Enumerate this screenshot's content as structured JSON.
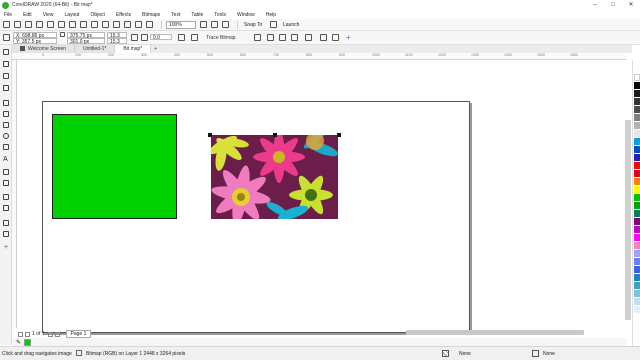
{
  "window": {
    "title": "CorelDRAW 2020 (64-Bit) - Bit map*",
    "controls": [
      "–",
      "□",
      "✕"
    ]
  },
  "menu": [
    "File",
    "Edit",
    "View",
    "Layout",
    "Object",
    "Effects",
    "Bitmaps",
    "Text",
    "Table",
    "Tools",
    "Window",
    "Help"
  ],
  "toolbar": {
    "zoom": "100%",
    "snap_to": "Snap To",
    "launch": "Launch"
  },
  "property_bar": {
    "x": "X: 698.86 px",
    "y": "Y: 357.5 px",
    "width": "375.75 px",
    "height": "301.0 px",
    "scale_w": "15.3",
    "scale_h": "15.3",
    "angle": "0.0",
    "trace_bitmap": "Trace Bitmap"
  },
  "tabs": [
    "Welcome Screen",
    "Untitled-1*",
    "Bit map*"
  ],
  "ruler_numbers": [
    "0",
    "100",
    "200",
    "300",
    "400",
    "500",
    "600",
    "700",
    "800",
    "900",
    "1000",
    "1100",
    "1200",
    "1300",
    "1400",
    "1500",
    "1600"
  ],
  "page_nav": {
    "page_label": "Page 1"
  },
  "status": {
    "hint": "Click and drag navigates image",
    "object_info": "Bitmap (RGB) on Layer 1 2448 x 3264 pixels",
    "fill": "None",
    "outline": "None"
  },
  "colors": {
    "green_fill": "#00d100",
    "palette": [
      "#ffffff",
      "#000000",
      "#1a1a1a",
      "#333333",
      "#4d4d4d",
      "#808080",
      "#b3b3b3",
      "#e6e6e6",
      "#00a3e0",
      "#0050b4",
      "#2020c0",
      "#ff0000",
      "#e2001a",
      "#ff8000",
      "#ffff00",
      "#00c000",
      "#00a000",
      "#008060",
      "#800080",
      "#c000c0",
      "#ff00ff",
      "#ff80c0",
      "#a0a0ff",
      "#6080ff",
      "#4060e0",
      "#2080c0",
      "#40a0c0",
      "#80c0e0",
      "#c0e0f0",
      "#e0f0f8"
    ]
  }
}
